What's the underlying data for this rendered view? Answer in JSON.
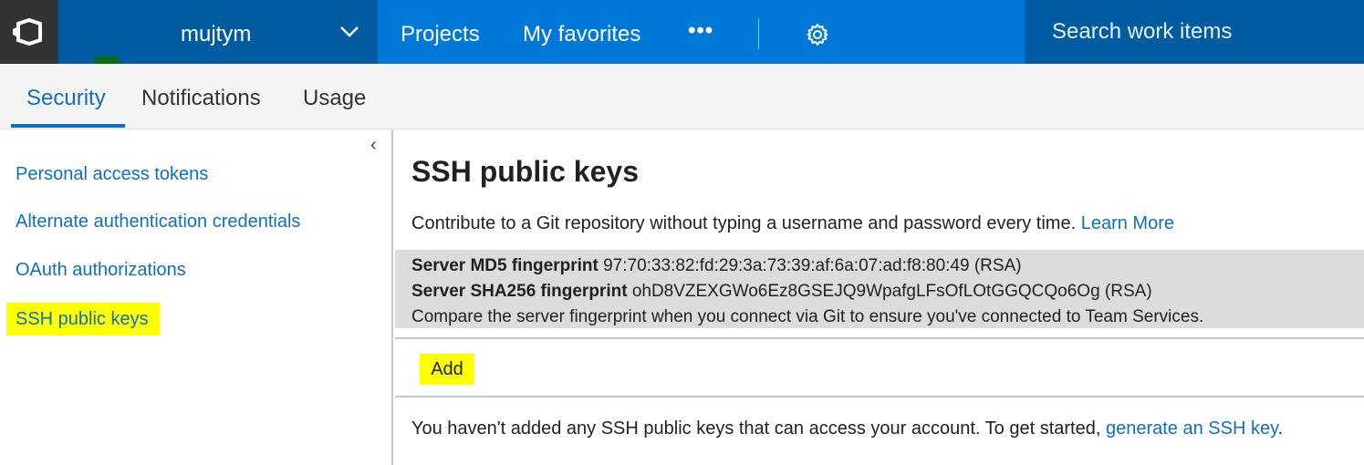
{
  "header": {
    "account_name": "mujtym",
    "nav": [
      "Projects",
      "My favorites"
    ],
    "search_placeholder": "Search work items",
    "icons": [
      "vsts-logo-icon",
      "chevron-down-icon",
      "more-icon",
      "gear-icon"
    ],
    "colors": {
      "bar": "#0078d7",
      "dark_bar": "#005ba1",
      "logo_bg": "#333333"
    }
  },
  "tabs": [
    {
      "label": "Security",
      "active": true
    },
    {
      "label": "Notifications",
      "active": false
    },
    {
      "label": "Usage",
      "active": false
    }
  ],
  "sidebar": {
    "collapse_icon": "‹",
    "items": [
      {
        "label": "Personal access tokens"
      },
      {
        "label": "Alternate authentication credentials"
      },
      {
        "label": "OAuth authorizations"
      },
      {
        "label": "SSH public keys",
        "highlighted": true
      }
    ]
  },
  "main": {
    "title": "SSH public keys",
    "intro_text": "Contribute to a Git repository without typing a username and password every time.",
    "learn_more": "Learn More",
    "md5_label": "Server MD5 fingerprint",
    "md5_value": "97:70:33:82:fd:29:3a:73:39:af:6a:07:ad:f8:80:49 (RSA)",
    "sha_label": "Server SHA256 fingerprint",
    "sha_value": "ohD8VZEXGWo6Ez8GSEJQ9WpafgLFsOfLOtGGQCQo6Og (RSA)",
    "compare_text": "Compare the server fingerprint when you connect via Git to ensure you've connected to Team Services.",
    "add_label": "Add",
    "empty_text": "You haven't added any SSH public keys that can access your account. To get started,",
    "generate_link": "generate an SSH key",
    "period": "."
  },
  "colors": {
    "link": "#106ebe",
    "highlight": "#ffff00"
  }
}
